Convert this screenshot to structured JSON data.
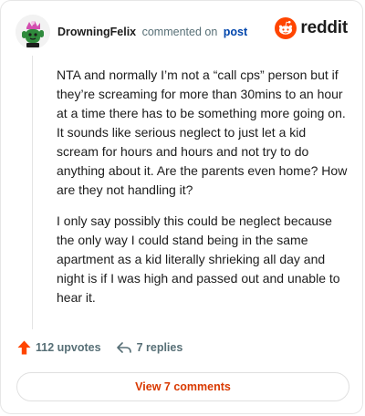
{
  "header": {
    "username": "DrowningFelix",
    "action_text": "commented on",
    "post_link": "post",
    "brand": "reddit"
  },
  "comment": {
    "paragraphs": [
      "NTA and normally I’m not a “call cps” person but if they’re screaming for more than 30mins to an hour at a time there has to be something more going on. It sounds like serious neglect to just let a kid scream for hours and hours and not try to do anything about it. Are the parents even home? How are they not handling it?",
      "I only say possibly this could be neglect because the only way I could stand being in the same apartment as a kid literally shrieking all day and night is if I was high and passed out and unable to hear it."
    ]
  },
  "actions": {
    "upvotes": "112 upvotes",
    "replies": "7 replies"
  },
  "view_button": "View 7 comments",
  "colors": {
    "upvote": "#ff4500",
    "brand": "#ff4500",
    "link": "#0045ac",
    "view_button_text": "#d93900",
    "muted": "#576f76"
  },
  "icons": {
    "avatar": "cactus-avatar",
    "brand": "reddit-snoo-icon",
    "upvote": "upvote-arrow-icon",
    "reply": "reply-arrow-icon"
  }
}
